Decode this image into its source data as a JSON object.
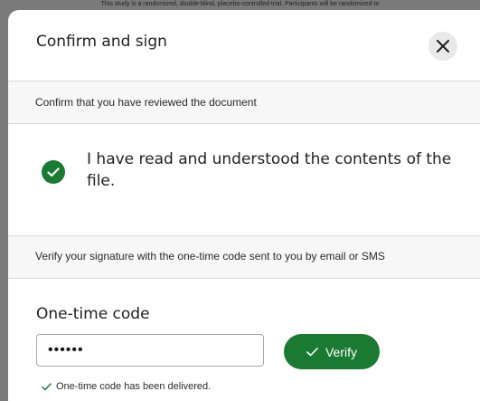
{
  "background": {
    "snippet": "This study is a randomized, double-blind, placebo-controlled trial. Participants will be randomized to"
  },
  "modal": {
    "title": "Confirm and sign",
    "close_icon": "close-icon",
    "review_section": {
      "label": "Confirm that you have reviewed the document"
    },
    "confirmation": {
      "text": "I have read and understood the contents of the file.",
      "checked": true
    },
    "verify_section": {
      "label": "Verify your signature with the one-time code sent to you by email or SMS"
    },
    "otp": {
      "label": "One-time code",
      "value": "••••••",
      "verify_label": "Verify",
      "status": "One-time code has been delivered."
    }
  },
  "colors": {
    "accent": "#1a7a32",
    "backdrop": "#7a7a7a",
    "section_bg": "#f7f7f7"
  }
}
